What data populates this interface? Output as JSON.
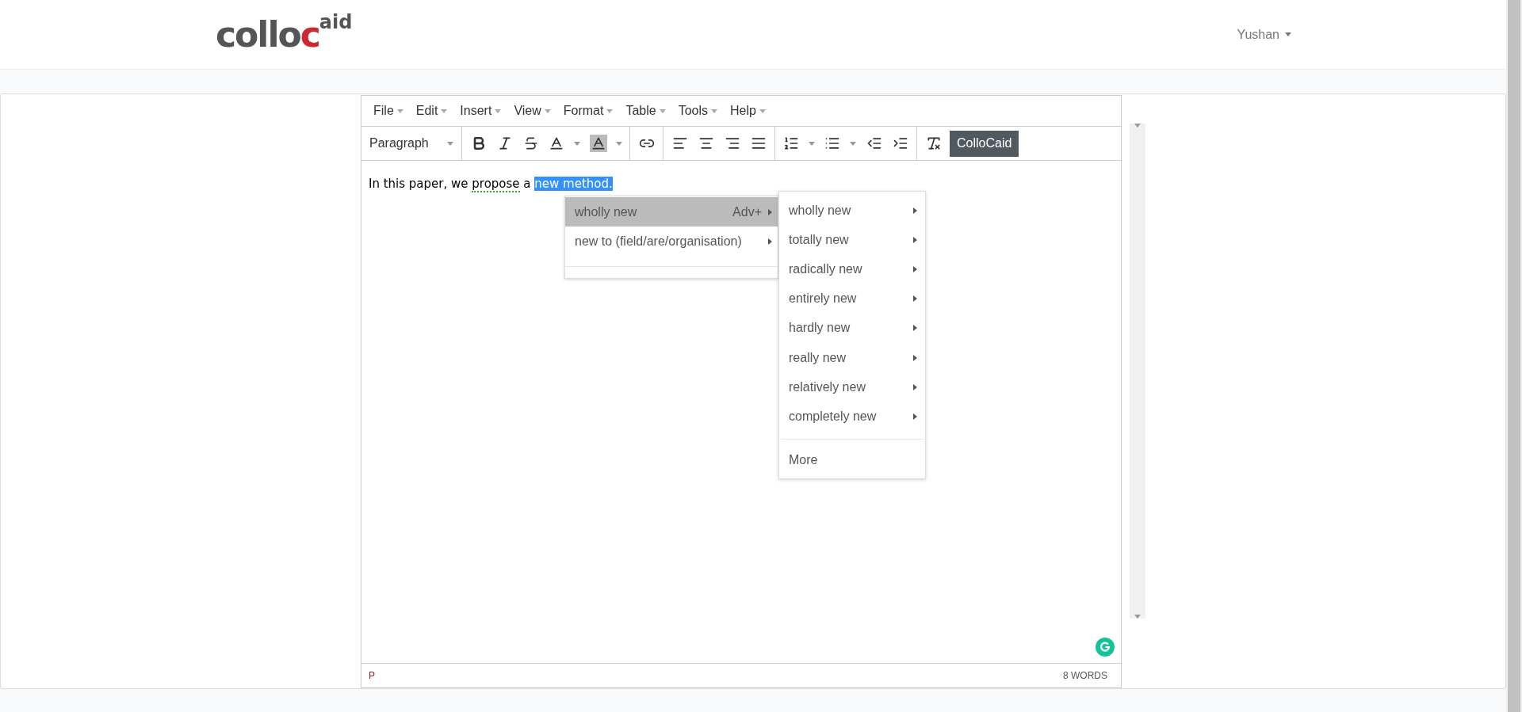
{
  "header": {
    "logo": {
      "main": "collo",
      "accent": "c",
      "raised": "aid"
    },
    "user_menu": "Yushan"
  },
  "editor": {
    "menubar": [
      "File",
      "Edit",
      "Insert",
      "View",
      "Format",
      "Table",
      "Tools",
      "Help"
    ],
    "toolbar": [
      {
        "kind": "select",
        "label": "Paragraph"
      },
      {
        "kind": "text",
        "label": "ColloCaid"
      }
    ],
    "content": [
      {
        "text": "In this paper, we ",
        "flagged": false,
        "selected": false
      },
      {
        "text": "propose",
        "flagged": true,
        "selected": false
      },
      {
        "text": " a ",
        "flagged": false,
        "selected": false
      },
      {
        "text": "new method.",
        "flagged": false,
        "selected": true
      }
    ],
    "context_menu": [
      {
        "label": "wholly new",
        "hint": "Adv+",
        "selected": true
      },
      {
        "label": "new to (field/are/organisation)",
        "selected": false
      }
    ],
    "submenu": {
      "items": [
        "wholly new",
        "totally new",
        "radically new",
        "entirely new",
        "hardly new",
        "really new",
        "relatively new",
        "completely new"
      ],
      "more": "More"
    },
    "status_path": "P",
    "word_count": "8 WORDS"
  }
}
